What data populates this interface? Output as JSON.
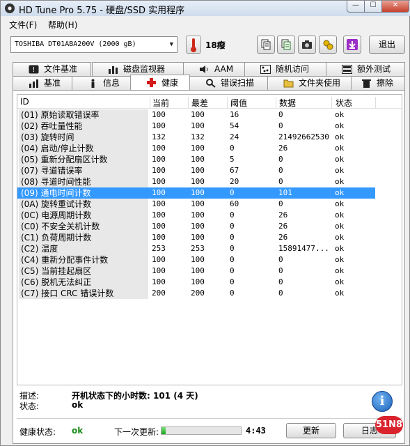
{
  "window": {
    "title": "HD Tune Pro 5.75 - 硬盘/SSD 实用程序",
    "minimize": "—",
    "maximize": "☐",
    "close": "✕"
  },
  "menu": {
    "file": "文件(F)",
    "help": "帮助(H)"
  },
  "toolbar": {
    "drive": "TOSHIBA DT01ABA200V (2000 gB)",
    "temperature": "18癈",
    "exit": "退出",
    "icons": [
      "copy-info-icon",
      "copy-all-icon",
      "screenshot-camera-icon",
      "options-icon",
      "save-download-icon"
    ]
  },
  "tabs_top": [
    {
      "label": "文件基准",
      "icon": "file-benchmark-icon"
    },
    {
      "label": "磁盘监视器",
      "icon": "disk-monitor-icon"
    },
    {
      "label": "AAM",
      "icon": "speaker-icon"
    },
    {
      "label": "随机访问",
      "icon": "random-access-icon"
    },
    {
      "label": "额外测试",
      "icon": "extra-tests-icon"
    }
  ],
  "tabs_bottom": [
    {
      "label": "基准",
      "icon": "benchmark-icon"
    },
    {
      "label": "信息",
      "icon": "info-icon"
    },
    {
      "label": "健康",
      "icon": "health-cross-icon",
      "active": true
    },
    {
      "label": "错误扫描",
      "icon": "magnifier-icon"
    },
    {
      "label": "文件夹使用",
      "icon": "folder-icon"
    },
    {
      "label": "擦除",
      "icon": "trash-icon"
    }
  ],
  "table": {
    "columns": [
      "ID",
      "当前",
      "最差",
      "阈值",
      "数据",
      "状态"
    ],
    "selected_index": 8,
    "rows": [
      [
        "(01) 原始读取错误率",
        "100",
        "100",
        "16",
        "0",
        "ok"
      ],
      [
        "(02) 吞吐量性能",
        "100",
        "100",
        "54",
        "0",
        "ok"
      ],
      [
        "(03) 旋转时间",
        "132",
        "132",
        "24",
        "21492662530",
        "ok"
      ],
      [
        "(04) 启动/停止计数",
        "100",
        "100",
        "0",
        "26",
        "ok"
      ],
      [
        "(05) 重新分配扇区计数",
        "100",
        "100",
        "5",
        "0",
        "ok"
      ],
      [
        "(07) 寻道错误率",
        "100",
        "100",
        "67",
        "0",
        "ok"
      ],
      [
        "(08) 寻道时间性能",
        "100",
        "100",
        "20",
        "0",
        "ok"
      ],
      [
        "(09) 通电时间计数",
        "100",
        "100",
        "0",
        "101",
        "ok"
      ],
      [
        "(0A) 旋转重试计数",
        "100",
        "100",
        "60",
        "0",
        "ok"
      ],
      [
        "(0C) 电源周期计数",
        "100",
        "100",
        "0",
        "26",
        "ok"
      ],
      [
        "(C0) 不安全关机计数",
        "100",
        "100",
        "0",
        "26",
        "ok"
      ],
      [
        "(C1) 负荷周期计数",
        "100",
        "100",
        "0",
        "26",
        "ok"
      ],
      [
        "(C2) 温度",
        "253",
        "253",
        "0",
        "15891477...",
        "ok"
      ],
      [
        "(C4) 重新分配事件计数",
        "100",
        "100",
        "0",
        "0",
        "ok"
      ],
      [
        "(C5) 当前挂起扇区",
        "100",
        "100",
        "0",
        "0",
        "ok"
      ],
      [
        "(C6) 脱机无法纠正",
        "100",
        "100",
        "0",
        "0",
        "ok"
      ],
      [
        "(C7) 接口 CRC 错误计数",
        "200",
        "200",
        "0",
        "0",
        "ok"
      ]
    ]
  },
  "details": {
    "desc_label": "描述:",
    "desc_value": "开机状态下的小时数: 101 (4 天)",
    "status_label": "状态:",
    "status_value": "ok"
  },
  "footer": {
    "health_label": "健康状态:",
    "health_value": "ok",
    "next_update_label": "下一次更新:",
    "progress_fraction": 0.05,
    "countdown": "4:43",
    "refresh_button": "更新",
    "log_button": "日志"
  },
  "watermark": "51N8",
  "colors": {
    "selection": "#3399ff",
    "ok_green": "#1a8a1a",
    "progress_green": "#18a818"
  }
}
